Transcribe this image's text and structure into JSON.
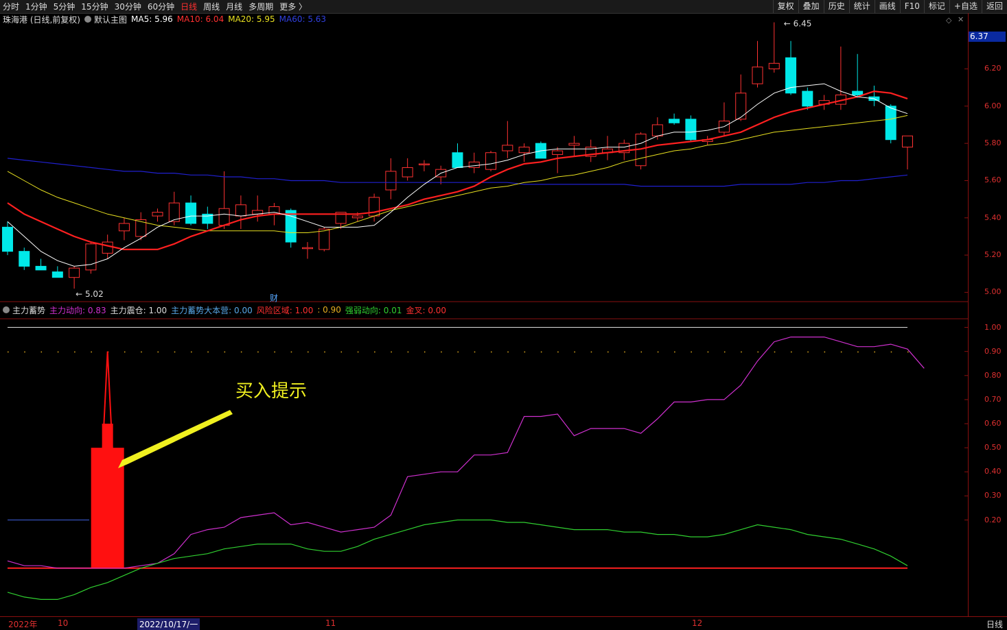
{
  "toolbar": {
    "periods": [
      "分时",
      "1分钟",
      "5分钟",
      "15分钟",
      "30分钟",
      "60分钟",
      "日线",
      "周线",
      "月线",
      "多周期",
      "更多 〉"
    ],
    "active_period": "日线",
    "tools": [
      "复权",
      "叠加",
      "历史",
      "统计",
      "画线",
      "F10",
      "标记",
      "+自选",
      "返回"
    ]
  },
  "main_legend": {
    "title": "珠海港 (日线,前复权)",
    "template": "默认主图",
    "ma5": "MA5: 5.96",
    "ma10": "MA10: 6.04",
    "ma20": "MA20: 5.95",
    "ma60": "MA60: 5.63"
  },
  "sub_legend": {
    "title": "主力蓄势",
    "items": [
      {
        "text": "主力动向: 0.83",
        "color": "#d030d0"
      },
      {
        "text": "主力震仓: 1.00",
        "color": "#dddddd"
      },
      {
        "text": "主力蓄势大本营: 0.00",
        "color": "#58a8e8"
      },
      {
        "text": "风险区域: 1.00",
        "color": "#ff3030"
      },
      {
        "text": ": 0.90",
        "color": "#e8b020"
      },
      {
        "text": "强弱动向: 0.01",
        "color": "#30d030"
      },
      {
        "text": "金叉: 0.00",
        "color": "#ff3030"
      }
    ]
  },
  "current_price": "6.37",
  "price_ticks": [
    "6.20",
    "6.00",
    "5.80",
    "5.60",
    "5.40",
    "5.20",
    "5.00"
  ],
  "osc_ticks": [
    "1.00",
    "0.90",
    "0.80",
    "0.70",
    "0.60",
    "0.50",
    "0.40",
    "0.30",
    "0.20"
  ],
  "annotations": {
    "high_label": "6.45",
    "low_label": "5.02",
    "cai_marker": "财",
    "buy_hint": "买入提示"
  },
  "date_axis": {
    "labels": [
      "2022年",
      "10",
      "11",
      "12"
    ],
    "cursor_date": "2022/10/17/一",
    "unit": "日线"
  },
  "colors": {
    "up": "#ff3232",
    "down": "#00e8e8",
    "ma5": "#ffffff",
    "ma10": "#ff2020",
    "ma20": "#e8e020",
    "ma60": "#2020d0",
    "main_force": "#d030d0",
    "strength": "#30d030"
  },
  "chart_data": {
    "type": "candlestick",
    "ylim": [
      4.95,
      6.5
    ],
    "candles": [
      {
        "o": 5.35,
        "h": 5.38,
        "l": 5.2,
        "c": 5.22
      },
      {
        "o": 5.22,
        "h": 5.24,
        "l": 5.12,
        "c": 5.14
      },
      {
        "o": 5.14,
        "h": 5.18,
        "l": 5.12,
        "c": 5.12
      },
      {
        "o": 5.11,
        "h": 5.14,
        "l": 5.08,
        "c": 5.08
      },
      {
        "o": 5.08,
        "h": 5.14,
        "l": 5.02,
        "c": 5.13
      },
      {
        "o": 5.12,
        "h": 5.27,
        "l": 5.1,
        "c": 5.26
      },
      {
        "o": 5.21,
        "h": 5.31,
        "l": 5.18,
        "c": 5.27
      },
      {
        "o": 5.33,
        "h": 5.4,
        "l": 5.28,
        "c": 5.37
      },
      {
        "o": 5.3,
        "h": 5.43,
        "l": 5.28,
        "c": 5.39
      },
      {
        "o": 5.41,
        "h": 5.45,
        "l": 5.38,
        "c": 5.43
      },
      {
        "o": 5.38,
        "h": 5.54,
        "l": 5.36,
        "c": 5.48
      },
      {
        "o": 5.48,
        "h": 5.52,
        "l": 5.36,
        "c": 5.37
      },
      {
        "o": 5.42,
        "h": 5.46,
        "l": 5.34,
        "c": 5.37
      },
      {
        "o": 5.36,
        "h": 5.65,
        "l": 5.34,
        "c": 5.45
      },
      {
        "o": 5.41,
        "h": 5.52,
        "l": 5.34,
        "c": 5.47
      },
      {
        "o": 5.42,
        "h": 5.52,
        "l": 5.38,
        "c": 5.44
      },
      {
        "o": 5.42,
        "h": 5.48,
        "l": 5.36,
        "c": 5.46
      },
      {
        "o": 5.44,
        "h": 5.45,
        "l": 5.24,
        "c": 5.27
      },
      {
        "o": 5.24,
        "h": 5.27,
        "l": 5.18,
        "c": 5.24
      },
      {
        "o": 5.23,
        "h": 5.35,
        "l": 5.22,
        "c": 5.34
      },
      {
        "o": 5.37,
        "h": 5.42,
        "l": 5.34,
        "c": 5.43
      },
      {
        "o": 5.4,
        "h": 5.43,
        "l": 5.38,
        "c": 5.41
      },
      {
        "o": 5.41,
        "h": 5.53,
        "l": 5.38,
        "c": 5.51
      },
      {
        "o": 5.55,
        "h": 5.72,
        "l": 5.5,
        "c": 5.65
      },
      {
        "o": 5.62,
        "h": 5.72,
        "l": 5.6,
        "c": 5.67
      },
      {
        "o": 5.69,
        "h": 5.71,
        "l": 5.65,
        "c": 5.69
      },
      {
        "o": 5.62,
        "h": 5.68,
        "l": 5.58,
        "c": 5.66
      },
      {
        "o": 5.75,
        "h": 5.8,
        "l": 5.67,
        "c": 5.67
      },
      {
        "o": 5.67,
        "h": 5.75,
        "l": 5.64,
        "c": 5.7
      },
      {
        "o": 5.66,
        "h": 5.76,
        "l": 5.65,
        "c": 5.75
      },
      {
        "o": 5.76,
        "h": 5.92,
        "l": 5.72,
        "c": 5.79
      },
      {
        "o": 5.75,
        "h": 5.8,
        "l": 5.7,
        "c": 5.78
      },
      {
        "o": 5.8,
        "h": 5.81,
        "l": 5.72,
        "c": 5.72
      },
      {
        "o": 5.74,
        "h": 5.78,
        "l": 5.64,
        "c": 5.76
      },
      {
        "o": 5.79,
        "h": 5.84,
        "l": 5.73,
        "c": 5.8
      },
      {
        "o": 5.73,
        "h": 5.82,
        "l": 5.7,
        "c": 5.78
      },
      {
        "o": 5.75,
        "h": 5.84,
        "l": 5.71,
        "c": 5.77
      },
      {
        "o": 5.75,
        "h": 5.82,
        "l": 5.71,
        "c": 5.8
      },
      {
        "o": 5.68,
        "h": 5.86,
        "l": 5.66,
        "c": 5.85
      },
      {
        "o": 5.84,
        "h": 5.94,
        "l": 5.82,
        "c": 5.9
      },
      {
        "o": 5.93,
        "h": 5.96,
        "l": 5.9,
        "c": 5.91
      },
      {
        "o": 5.93,
        "h": 5.95,
        "l": 5.81,
        "c": 5.82
      },
      {
        "o": 5.81,
        "h": 5.84,
        "l": 5.79,
        "c": 5.82
      },
      {
        "o": 5.86,
        "h": 6.02,
        "l": 5.84,
        "c": 5.92
      },
      {
        "o": 5.93,
        "h": 6.17,
        "l": 5.92,
        "c": 6.07
      },
      {
        "o": 6.12,
        "h": 6.35,
        "l": 6.1,
        "c": 6.21
      },
      {
        "o": 6.2,
        "h": 6.45,
        "l": 6.18,
        "c": 6.23
      },
      {
        "o": 6.26,
        "h": 6.35,
        "l": 6.06,
        "c": 6.07
      },
      {
        "o": 6.08,
        "h": 6.1,
        "l": 5.98,
        "c": 6.0
      },
      {
        "o": 6.01,
        "h": 6.06,
        "l": 5.98,
        "c": 6.03
      },
      {
        "o": 6.01,
        "h": 6.32,
        "l": 5.98,
        "c": 6.06
      },
      {
        "o": 6.08,
        "h": 6.28,
        "l": 6.05,
        "c": 6.06
      },
      {
        "o": 6.05,
        "h": 6.11,
        "l": 6.0,
        "c": 6.03
      },
      {
        "o": 6.0,
        "h": 6.01,
        "l": 5.8,
        "c": 5.82
      },
      {
        "o": 5.78,
        "h": 5.84,
        "l": 5.66,
        "c": 5.84
      }
    ],
    "ma5": [
      5.38,
      5.3,
      5.22,
      5.17,
      5.14,
      5.15,
      5.18,
      5.24,
      5.29,
      5.35,
      5.39,
      5.41,
      5.41,
      5.42,
      5.41,
      5.42,
      5.43,
      5.41,
      5.38,
      5.35,
      5.35,
      5.35,
      5.36,
      5.43,
      5.51,
      5.58,
      5.64,
      5.67,
      5.68,
      5.69,
      5.71,
      5.74,
      5.76,
      5.77,
      5.77,
      5.77,
      5.78,
      5.78,
      5.8,
      5.84,
      5.86,
      5.86,
      5.87,
      5.89,
      5.94,
      6.01,
      6.07,
      6.1,
      6.11,
      6.12,
      6.08,
      6.05,
      6.04,
      5.99,
      5.96
    ],
    "ma10": [
      5.48,
      5.42,
      5.38,
      5.34,
      5.3,
      5.27,
      5.25,
      5.23,
      5.23,
      5.23,
      5.26,
      5.3,
      5.33,
      5.36,
      5.39,
      5.41,
      5.42,
      5.42,
      5.42,
      5.42,
      5.42,
      5.42,
      5.43,
      5.45,
      5.47,
      5.5,
      5.52,
      5.54,
      5.57,
      5.62,
      5.66,
      5.69,
      5.7,
      5.72,
      5.73,
      5.74,
      5.75,
      5.76,
      5.77,
      5.79,
      5.8,
      5.81,
      5.82,
      5.84,
      5.86,
      5.9,
      5.94,
      5.97,
      5.99,
      6.01,
      6.03,
      6.05,
      6.08,
      6.07,
      6.04
    ],
    "ma20": [
      5.65,
      5.6,
      5.55,
      5.51,
      5.48,
      5.45,
      5.42,
      5.4,
      5.38,
      5.36,
      5.35,
      5.34,
      5.33,
      5.33,
      5.33,
      5.33,
      5.33,
      5.32,
      5.32,
      5.33,
      5.35,
      5.38,
      5.41,
      5.44,
      5.46,
      5.48,
      5.5,
      5.52,
      5.54,
      5.56,
      5.57,
      5.59,
      5.6,
      5.62,
      5.63,
      5.65,
      5.67,
      5.7,
      5.72,
      5.74,
      5.76,
      5.77,
      5.79,
      5.8,
      5.82,
      5.84,
      5.86,
      5.87,
      5.88,
      5.89,
      5.9,
      5.91,
      5.92,
      5.93,
      5.95
    ],
    "ma60": [
      5.72,
      5.71,
      5.7,
      5.69,
      5.68,
      5.67,
      5.66,
      5.65,
      5.65,
      5.64,
      5.64,
      5.63,
      5.63,
      5.62,
      5.62,
      5.61,
      5.61,
      5.6,
      5.6,
      5.6,
      5.59,
      5.59,
      5.59,
      5.59,
      5.59,
      5.59,
      5.59,
      5.59,
      5.59,
      5.59,
      5.59,
      5.58,
      5.58,
      5.58,
      5.58,
      5.58,
      5.58,
      5.58,
      5.57,
      5.57,
      5.57,
      5.57,
      5.57,
      5.57,
      5.58,
      5.58,
      5.58,
      5.58,
      5.59,
      5.59,
      5.6,
      5.6,
      5.61,
      5.62,
      5.63
    ],
    "osc_ylim": [
      -0.2,
      1.05
    ],
    "main_force": [
      0.03,
      0.01,
      0.01,
      0.0,
      0.0,
      0.0,
      0.0,
      0.0,
      0.01,
      0.02,
      0.06,
      0.14,
      0.16,
      0.17,
      0.21,
      0.22,
      0.23,
      0.18,
      0.19,
      0.17,
      0.15,
      0.16,
      0.17,
      0.22,
      0.38,
      0.39,
      0.4,
      0.4,
      0.47,
      0.47,
      0.48,
      0.63,
      0.63,
      0.64,
      0.55,
      0.58,
      0.58,
      0.58,
      0.56,
      0.62,
      0.69,
      0.69,
      0.7,
      0.7,
      0.76,
      0.86,
      0.94,
      0.96,
      0.96,
      0.96,
      0.94,
      0.92,
      0.92,
      0.93,
      0.91,
      0.83
    ],
    "strength": [
      -0.1,
      -0.12,
      -0.13,
      -0.13,
      -0.11,
      -0.08,
      -0.06,
      -0.03,
      0.0,
      0.02,
      0.04,
      0.05,
      0.06,
      0.08,
      0.09,
      0.1,
      0.1,
      0.1,
      0.08,
      0.07,
      0.07,
      0.09,
      0.12,
      0.14,
      0.16,
      0.18,
      0.19,
      0.2,
      0.2,
      0.2,
      0.19,
      0.19,
      0.18,
      0.17,
      0.16,
      0.16,
      0.16,
      0.15,
      0.15,
      0.14,
      0.14,
      0.13,
      0.13,
      0.14,
      0.16,
      0.18,
      0.17,
      0.16,
      0.14,
      0.13,
      0.12,
      0.1,
      0.08,
      0.05,
      0.01
    ],
    "signal_bar": {
      "index": 6,
      "value": 0.5,
      "peak": 0.9,
      "inner": 0.6
    }
  }
}
